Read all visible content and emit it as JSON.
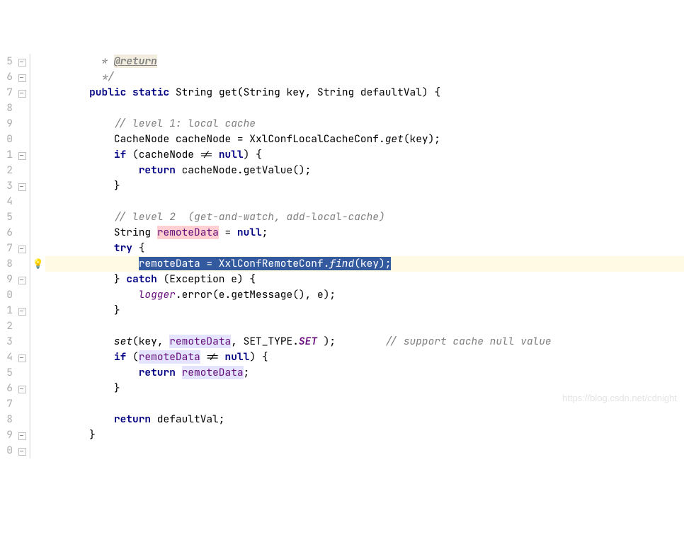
{
  "lines": [
    {
      "n": "5",
      "fold": "open",
      "icon": "",
      "cls": "",
      "html": "    <span class='comment'> * </span><span class='tag-return'>@return</span>"
    },
    {
      "n": "6",
      "fold": "open",
      "icon": "",
      "cls": "",
      "html": "    <span class='comment'> */</span>"
    },
    {
      "n": "7",
      "fold": "open",
      "icon": "",
      "cls": "",
      "html": "   <span class='kw'>public</span> <span class='kw'>static</span> String get(String key, String defaultVal) {"
    },
    {
      "n": "8",
      "fold": "",
      "icon": "",
      "cls": "",
      "html": ""
    },
    {
      "n": "9",
      "fold": "",
      "icon": "",
      "cls": "",
      "html": "       <span class='comment'>// level 1: local cache</span>"
    },
    {
      "n": "0",
      "fold": "",
      "icon": "",
      "cls": "",
      "html": "       CacheNode cacheNode = XxlConfLocalCacheConf.<span class='static-call'>get</span>(key);"
    },
    {
      "n": "1",
      "fold": "open",
      "icon": "",
      "cls": "",
      "html": "       <span class='kw'>if</span> (cacheNode != <span class='kw'>null</span>) {"
    },
    {
      "n": "2",
      "fold": "",
      "icon": "",
      "cls": "",
      "html": "           <span class='kw'>return</span> cacheNode.getValue();"
    },
    {
      "n": "3",
      "fold": "open",
      "icon": "",
      "cls": "",
      "html": "       }"
    },
    {
      "n": "4",
      "fold": "",
      "icon": "",
      "cls": "",
      "html": ""
    },
    {
      "n": "5",
      "fold": "",
      "icon": "",
      "cls": "",
      "html": "       <span class='comment'>// level 2  (get-and-watch, add-local-cache)</span>"
    },
    {
      "n": "6",
      "fold": "",
      "icon": "",
      "cls": "",
      "html": "       String <span class='var-write'>remoteData</span> = <span class='kw'>null</span>;"
    },
    {
      "n": "7",
      "fold": "open",
      "icon": "",
      "cls": "",
      "html": "       <span class='kw'>try</span> {"
    },
    {
      "n": "8",
      "fold": "",
      "icon": "bulb",
      "cls": "highlight-line",
      "html": "           <span class='sel'>remoteData = XxlConfRemoteConf.<span class='static-call'>find</span>(key);</span>"
    },
    {
      "n": "9",
      "fold": "open",
      "icon": "",
      "cls": "",
      "html": "       } <span class='kw'>catch</span> (Exception e) {"
    },
    {
      "n": "0",
      "fold": "",
      "icon": "",
      "cls": "",
      "html": "           <span class='field-ref'>logger</span>.error(e.getMessage(), e);"
    },
    {
      "n": "1",
      "fold": "open",
      "icon": "",
      "cls": "",
      "html": "       }"
    },
    {
      "n": "2",
      "fold": "",
      "icon": "",
      "cls": "",
      "html": ""
    },
    {
      "n": "3",
      "fold": "",
      "icon": "",
      "cls": "",
      "html": "       <span class='static-call'>set</span>(key, <span class='var-hi'>remoteData</span>, SET_TYPE.<span class='enum-ref'>SET</span> );        <span class='comment'>// support cache null value</span>"
    },
    {
      "n": "4",
      "fold": "open",
      "icon": "",
      "cls": "",
      "html": "       <span class='kw'>if</span> (<span class='var-hi'>remoteData</span> != <span class='kw'>null</span>) {"
    },
    {
      "n": "5",
      "fold": "",
      "icon": "",
      "cls": "",
      "html": "           <span class='kw'>return</span> <span class='var-hi'>remoteData</span>;"
    },
    {
      "n": "6",
      "fold": "open",
      "icon": "",
      "cls": "",
      "html": "       }"
    },
    {
      "n": "7",
      "fold": "",
      "icon": "",
      "cls": "",
      "html": ""
    },
    {
      "n": "8",
      "fold": "",
      "icon": "",
      "cls": "",
      "html": "       <span class='kw'>return</span> defaultVal;"
    },
    {
      "n": "9",
      "fold": "open",
      "icon": "",
      "cls": "",
      "html": "   }"
    },
    {
      "n": "0",
      "fold": "open",
      "icon": "",
      "cls": "",
      "html": ""
    }
  ],
  "watermark": "https://blog.csdn.net/cdnight"
}
